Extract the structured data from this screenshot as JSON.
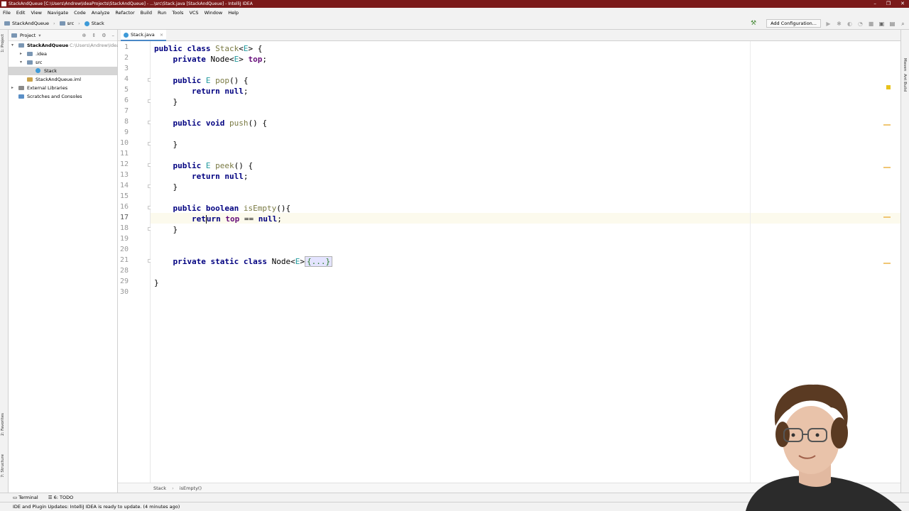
{
  "window": {
    "title": "StackAndQueue [C:\\Users\\Andrew\\IdeaProjects\\StackAndQueue] - ...\\src\\Stack.java [StackAndQueue] - IntelliJ IDEA",
    "controls": [
      "–",
      "❐",
      "✕"
    ]
  },
  "menu": [
    "File",
    "Edit",
    "View",
    "Navigate",
    "Code",
    "Analyze",
    "Refactor",
    "Build",
    "Run",
    "Tools",
    "VCS",
    "Window",
    "Help"
  ],
  "nav": {
    "crumbs": [
      "StackAndQueue",
      "src",
      "Stack"
    ],
    "add_config": "Add Configuration..."
  },
  "left_tabs": {
    "project": "1: Project",
    "favorites": "2: Favorites",
    "structure": "7: Structure"
  },
  "right_tabs": {
    "maven": "Maven",
    "ant": "Ant Build"
  },
  "project_panel": {
    "title": "Project",
    "tree": [
      {
        "label": "StackAndQueue",
        "path": "C:\\Users\\Andrew\\Idea",
        "level": 0,
        "arrow": "▾",
        "icon": "folder-icon",
        "bold": true
      },
      {
        "label": ".idea",
        "level": 1,
        "arrow": "▸",
        "icon": "folder-icon"
      },
      {
        "label": "src",
        "level": 1,
        "arrow": "▾",
        "icon": "folder-icon"
      },
      {
        "label": "Stack",
        "level": 2,
        "arrow": "",
        "icon": "class-icon",
        "selected": true
      },
      {
        "label": "StackAndQueue.iml",
        "level": 1,
        "arrow": "",
        "icon": "file-icon"
      },
      {
        "label": "External Libraries",
        "level": 0,
        "arrow": "▸",
        "icon": "library-icon"
      },
      {
        "label": "Scratches and Consoles",
        "level": 0,
        "arrow": "",
        "icon": "scratch-icon"
      }
    ]
  },
  "editor_tab": {
    "label": "Stack.java"
  },
  "code": {
    "line_numbers": [
      "1",
      "2",
      "3",
      "4",
      "5",
      "6",
      "7",
      "8",
      "9",
      "10",
      "11",
      "12",
      "13",
      "14",
      "15",
      "16",
      "17",
      "18",
      "19",
      "20",
      "21",
      "28",
      "29",
      "30"
    ],
    "current_line": "17",
    "l1_kw": "public class ",
    "l1_name": "Stack",
    "l1_lt": "<",
    "l1_tp": "E",
    "l1_rest": "> {",
    "l2_kw": "private ",
    "l2_type": "Node<",
    "l2_tp": "E",
    "l2_gt": "> ",
    "l2_fd": "top",
    "l2_end": ";",
    "l4_kw": "public ",
    "l4_tp": "E ",
    "l4_fn": "pop",
    "l4_rest": "() {",
    "ret_kw": "return ",
    "null_kw": "null",
    "semi": ";",
    "close": "}",
    "l8_kw": "public void ",
    "l8_fn": "push",
    "l8_rest": "() {",
    "l12_kw": "public ",
    "l12_tp": "E ",
    "l12_fn": "peek",
    "l12_rest": "() {",
    "l16_kw": "public boolean ",
    "l16_fn": "isEmpty",
    "l16_rest": "(){",
    "l17_kw_a": "ret",
    "l17_kw_b": "urn ",
    "l17_fd": "top",
    "l17_op": " == ",
    "l17_null": "null",
    "l17_end": ";",
    "l21_kw": "private static class ",
    "l21_type": "Node<",
    "l21_tp": "E",
    "l21_gt": ">",
    "l21_fold": "{...}"
  },
  "editor_breadcrumb": [
    "Stack",
    "isEmpty()"
  ],
  "bottom_tools": [
    "Terminal",
    "6: TODO"
  ],
  "status": "IDE and Plugin Updates: IntelliJ IDEA is ready to update. (4 minutes ago)"
}
